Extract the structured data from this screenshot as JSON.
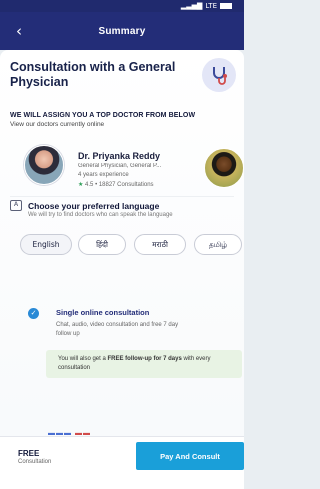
{
  "status_bar": {
    "text": "LTE"
  },
  "header": {
    "back_glyph": "‹",
    "title": "Summary"
  },
  "consultation": {
    "title": "Consultation with a General Physician",
    "icon": "stethoscope-icon"
  },
  "assign": {
    "heading": "WE WILL ASSIGN YOU A TOP DOCTOR FROM BELOW",
    "subheading": "View our doctors currently online"
  },
  "doctor": {
    "name": "Dr. Priyanka Reddy",
    "speciality": "General Physician, General P...",
    "experience": "4 years experience",
    "rating_prefix": "★",
    "rating_text": " 4.5 • 18827 Consultations"
  },
  "language": {
    "heading": "Choose your preferred language",
    "subheading": "We will try to find doctors who can speak the language",
    "options": [
      "English",
      "हिंदी",
      "मराठी",
      "தமிழ்"
    ]
  },
  "plan": {
    "title": "Single online consultation",
    "description": "Chat, audio, video consultation and free 7 day follow up",
    "followup_prefix": "You will also get a ",
    "followup_bold": "FREE follow-up for 7 days",
    "followup_suffix": " with every consultation"
  },
  "footer": {
    "price": "FREE",
    "price_label": "Consultation",
    "pay_button": "Pay And Consult"
  },
  "colors": {
    "header": "#232d78",
    "accent": "#1a9fd9",
    "followup_bg": "#e8f3e4"
  }
}
